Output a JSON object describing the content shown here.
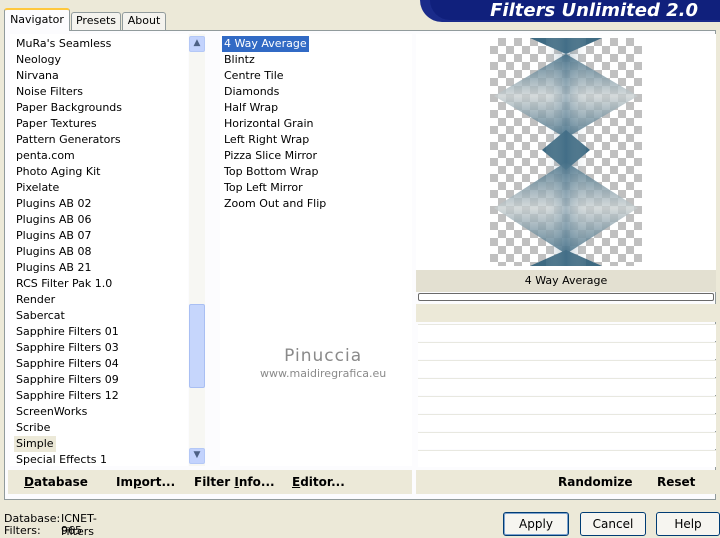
{
  "tabs": [
    {
      "label": "Navigator"
    },
    {
      "label": "Presets"
    },
    {
      "label": "About"
    }
  ],
  "banner": {
    "title": "Filters Unlimited 2.0"
  },
  "categories": [
    "MuRa's Seamless",
    "Neology",
    "Nirvana",
    "Noise Filters",
    "Paper Backgrounds",
    "Paper Textures",
    "Pattern Generators",
    "penta.com",
    "Photo Aging Kit",
    "Pixelate",
    "Plugins AB 02",
    "Plugins AB 06",
    "Plugins AB 07",
    "Plugins AB 08",
    "Plugins AB 21",
    "RCS Filter Pak 1.0",
    "Render",
    "Sabercat",
    "Sapphire Filters 01",
    "Sapphire Filters 03",
    "Sapphire Filters 04",
    "Sapphire Filters 09",
    "Sapphire Filters 12",
    "ScreenWorks",
    "Scribe",
    "Simple",
    "Special Effects 1"
  ],
  "selected_category": "Simple",
  "filters": [
    "4 Way Average",
    "Blintz",
    "Centre Tile",
    "Diamonds",
    "Half Wrap",
    "Horizontal Grain",
    "Left Right Wrap",
    "Pizza Slice Mirror",
    "Top Bottom Wrap",
    "Top Left Mirror",
    "Zoom Out and Flip"
  ],
  "selected_filter": "4 Way Average",
  "preview": {
    "filter_name": "4 Way Average"
  },
  "left_buttons": {
    "database": "Database",
    "import": "Import...",
    "filter_info": "Filter Info...",
    "editor": "Editor..."
  },
  "right_buttons": {
    "randomize": "Randomize",
    "reset": "Reset"
  },
  "status": {
    "database_label": "Database:",
    "database_value": "ICNET-Filters",
    "filters_label": "Filters:",
    "filters_value": "965"
  },
  "dialog_buttons": {
    "apply": "Apply",
    "cancel": "Cancel",
    "help": "Help"
  },
  "watermark": {
    "line1": "Pinuccia",
    "line2": "www.maidiregrafica.eu"
  },
  "colors": {
    "selection": "#316ac5",
    "banner": "#10207c",
    "preview_tone": "#3e6a82"
  }
}
